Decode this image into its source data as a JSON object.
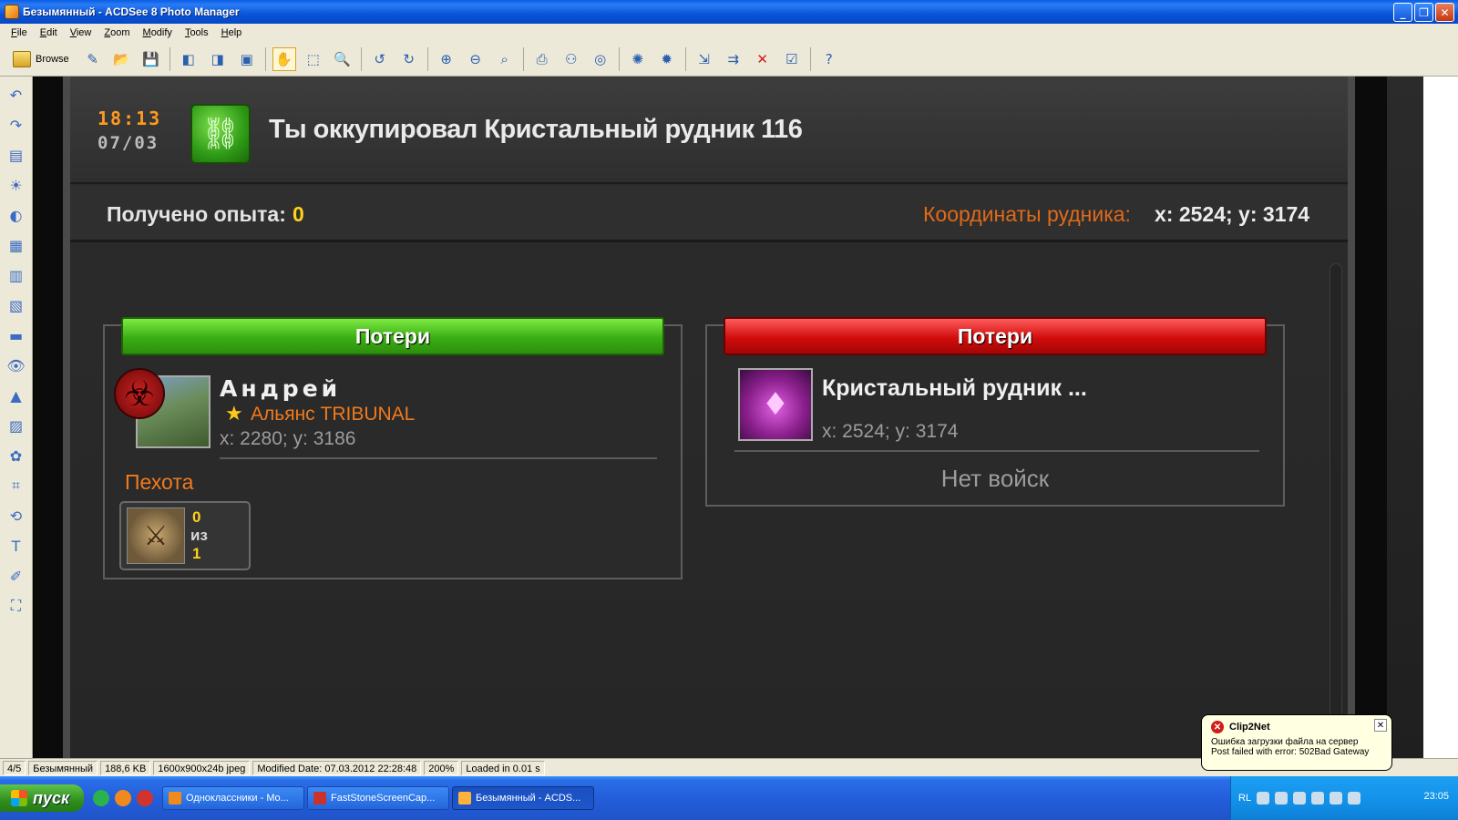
{
  "window": {
    "title": "Безымянный - ACDSee 8 Photo Manager",
    "controls": {
      "minimize": "_",
      "maximize": "❐",
      "close": "✕"
    }
  },
  "menu": [
    "File",
    "Edit",
    "View",
    "Zoom",
    "Modify",
    "Tools",
    "Help"
  ],
  "toolbar": {
    "browse_label": "Browse"
  },
  "game": {
    "time": "18:13",
    "date": "07/03",
    "event_title": "Ты оккупировал Кристальный рудник 116",
    "xp_label": "Получено опыта:",
    "xp_value": "0",
    "coords_label": "Координаты рудника:",
    "coords_value": "x: 2524; y: 3174",
    "left_panel": {
      "header": "Потери",
      "player_name": "Андрей",
      "alliance": "Альянс TRIBUNAL",
      "player_coords": "x: 2280; y: 3186",
      "unit_category": "Пехота",
      "unit_count_top": "0",
      "unit_of": "из",
      "unit_count_bottom": "1"
    },
    "right_panel": {
      "header": "Потери",
      "mine_name": "Кристальный рудник ...",
      "mine_coords": "x: 2524; y: 3174",
      "no_troops": "Нет войск"
    }
  },
  "status": {
    "index": "4/5",
    "filename": "Безымянный",
    "size": "188,6 KB",
    "dimensions": "1600x900x24b jpeg",
    "modified": "Modified Date: 07.03.2012 22:28:48",
    "zoom": "200%",
    "loaded": "Loaded in 0.01 s"
  },
  "taskbar": {
    "start": "пуск",
    "tasks": [
      "Одноклассники - Mo...",
      "FastStoneScreenCap...",
      "Безымянный - ACDS..."
    ],
    "lang": "RL",
    "clock": "23:05"
  },
  "balloon": {
    "title": "Clip2Net",
    "line1": "Ошибка загрузки файла на сервер",
    "line2": "Post failed with error: 502Bad Gateway"
  },
  "colors": {
    "accent_orange": "#f07a1c",
    "xp_yellow": "#ffd21a",
    "green_header": "#3aae14",
    "red_header": "#d10c0c"
  }
}
